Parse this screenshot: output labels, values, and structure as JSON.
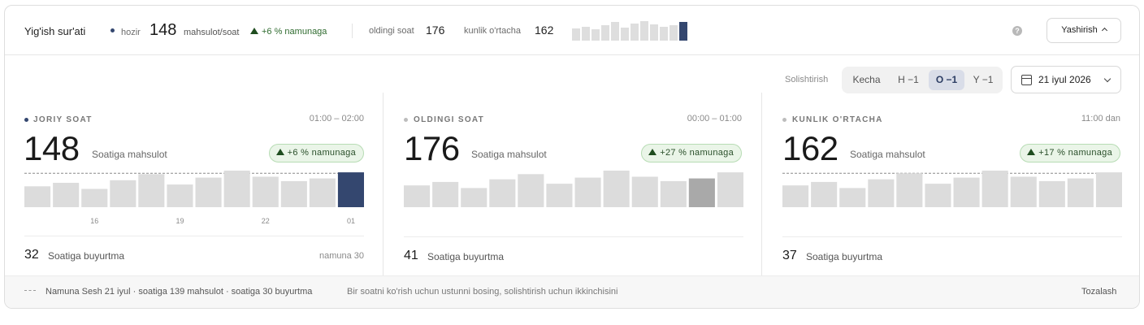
{
  "header": {
    "title": "Yig'ish sur'ati",
    "now_label": "hozir",
    "now_value": "148",
    "now_unit": "mahsulot/soat",
    "now_delta": "+6 % namunaga",
    "prev_label": "oldingi soat",
    "prev_value": "176",
    "avg_label": "kunlik o'rtacha",
    "avg_value": "162",
    "sparkline": [
      14,
      16,
      13,
      17,
      21,
      15,
      19,
      22,
      18,
      16,
      17,
      21
    ],
    "help_icon": "help-icon",
    "hide_label": "Yashirish"
  },
  "compare": {
    "label": "Solishtirish",
    "options": [
      "Kecha",
      "H −1",
      "O −1",
      "Y −1"
    ],
    "active_option": "O −1",
    "date": "21 iyul 2026"
  },
  "panels": [
    {
      "title": "JORIY SOAT",
      "time": "01:00 – 02:00",
      "value": "148",
      "unit": "Soatiga mahsulot",
      "delta": "+6 % namunaga",
      "bars": [
        24,
        28,
        21,
        31,
        38,
        26,
        34,
        42,
        35,
        30,
        33,
        40
      ],
      "highlight_index": 11,
      "highlight_color": "#34476f",
      "target_line": 39,
      "x_ticks": [
        "16",
        "19",
        "22",
        "01"
      ],
      "orders_value": "32",
      "orders_label": "Soatiga buyurtma",
      "target_label": "namuna 30",
      "dot_color": "#34476f"
    },
    {
      "title": "OLDINGI SOAT",
      "time": "00:00 – 01:00",
      "value": "176",
      "unit": "Soatiga mahsulot",
      "delta": "+27 % namunaga",
      "bars": [
        25,
        29,
        22,
        32,
        38,
        27,
        34,
        42,
        35,
        30,
        33,
        40
      ],
      "highlight_index": 10,
      "highlight_color": "#a9a9a9",
      "orders_value": "41",
      "orders_label": "Soatiga buyurtma",
      "dot_color": "#bdbdbd"
    },
    {
      "title": "KUNLIK O'RTACHA",
      "time": "11:00 dan",
      "value": "162",
      "unit": "Soatiga mahsulot",
      "delta": "+17 % namunaga",
      "bars": [
        25,
        29,
        22,
        32,
        39,
        27,
        34,
        42,
        35,
        30,
        33,
        40
      ],
      "target_line": 39,
      "orders_value": "37",
      "orders_label": "Soatiga buyurtma",
      "dot_color": "#bdbdbd"
    }
  ],
  "footer": {
    "legend": "Namuna Sesh 21 iyul · soatiga 139 mahsulot · soatiga 30 buyurtma",
    "hint": "Bir soatni ko'rish uchun ustunni bosing, solishtirish uchun ikkinchisini",
    "clear_label": "Tozalash"
  },
  "colors": {
    "accent": "#34476f",
    "bar": "#dcdcdc",
    "positive_bg": "#eaf5e8",
    "positive_border": "#b7dcb4"
  }
}
